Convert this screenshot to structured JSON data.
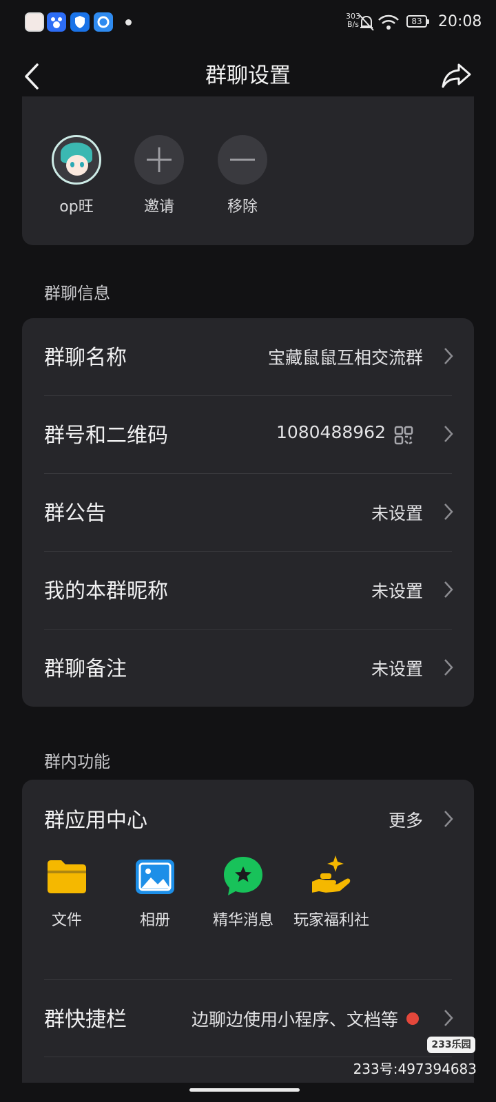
{
  "status_bar": {
    "net_speed_value": "303",
    "net_speed_unit": "B/s",
    "battery": "83",
    "time": "20:08"
  },
  "header": {
    "title": "群聊设置",
    "back_icon": "chevron-left-icon",
    "share_icon": "share-icon"
  },
  "members": {
    "items": [
      {
        "name": "op旺"
      },
      {
        "name": "邀请",
        "icon": "plus-icon"
      },
      {
        "name": "移除",
        "icon": "minus-icon"
      }
    ]
  },
  "group_info": {
    "section_title": "群聊信息",
    "rows": [
      {
        "label": "群聊名称",
        "value": "宝藏鼠鼠互相交流群"
      },
      {
        "label": "群号和二维码",
        "value": "1080488962"
      },
      {
        "label": "群公告",
        "value": "未设置"
      },
      {
        "label": "我的本群昵称",
        "value": "未设置"
      },
      {
        "label": "群聊备注",
        "value": "未设置"
      }
    ]
  },
  "group_features": {
    "section_title": "群内功能",
    "app_center": {
      "label": "群应用中心",
      "more": "更多"
    },
    "apps": [
      {
        "label": "文件",
        "icon": "folder-icon",
        "color": "#f5b800"
      },
      {
        "label": "相册",
        "icon": "photo-icon",
        "color": "#1d8fe8"
      },
      {
        "label": "精华消息",
        "icon": "star-chat-icon",
        "color": "#18c25a"
      },
      {
        "label": "玩家福利社",
        "icon": "gift-hand-icon",
        "color": "#f5b800"
      }
    ],
    "shortcut_bar": {
      "label": "群快捷栏",
      "value": "边聊边使用小程序、文档等"
    }
  },
  "watermark": {
    "logo": "233乐园",
    "id": "233号:497394683"
  }
}
